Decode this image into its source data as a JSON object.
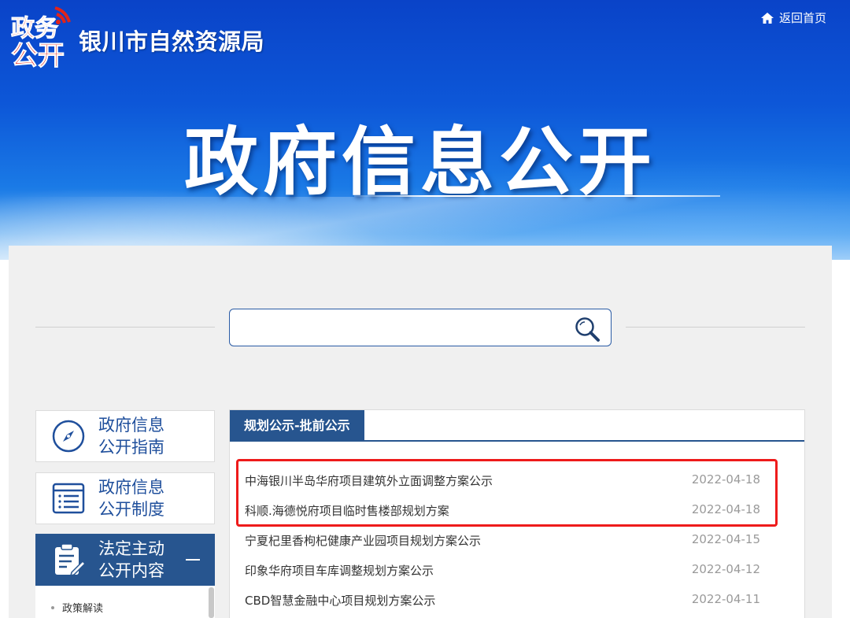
{
  "header": {
    "site_name": "银川市自然资源局",
    "home_link": "返回首页",
    "banner_title": "政府信息公开",
    "logo_text": "政务公开"
  },
  "search": {
    "placeholder": ""
  },
  "sidebar": {
    "items": [
      {
        "label": "政府信息公开指南",
        "icon": "compass-icon"
      },
      {
        "label": "政府信息公开制度",
        "icon": "list-icon"
      },
      {
        "label": "法定主动公开内容",
        "icon": "clipboard-edit-icon"
      }
    ],
    "submenu": [
      {
        "label": "政策解读"
      }
    ]
  },
  "content": {
    "tab_label": "规划公示-批前公示",
    "items": [
      {
        "title": "中海银川半岛华府项目建筑外立面调整方案公示",
        "date": "2022-04-18"
      },
      {
        "title": "科顺.海德悦府项目临时售楼部规划方案",
        "date": "2022-04-18"
      },
      {
        "title": "宁夏杞里香枸杞健康产业园项目规划方案公示",
        "date": "2022-04-15"
      },
      {
        "title": "印象华府项目车库调整规划方案公示",
        "date": "2022-04-12"
      },
      {
        "title": "CBD智慧金融中心项目规划方案公示",
        "date": "2022-04-11"
      }
    ]
  },
  "colors": {
    "brand_blue": "#27558f",
    "highlight_red": "#ee1b1b",
    "logo_red": "#e2231a"
  }
}
